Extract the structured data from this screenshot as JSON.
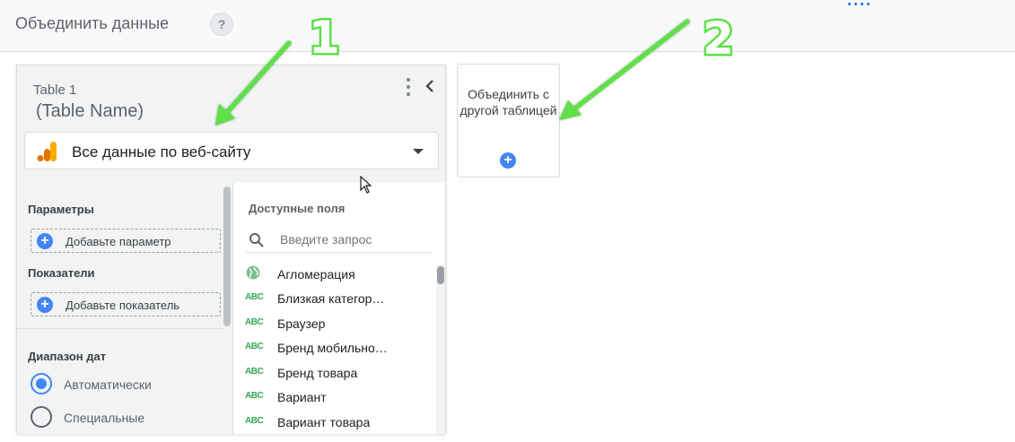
{
  "header": {
    "title": "Объединить данные",
    "help_icon": "?"
  },
  "panel": {
    "table_label": "Table 1",
    "table_name": "(Table Name)",
    "data_source": "Все данные по веб-сайту",
    "data_source_icon": "google-analytics-icon",
    "parameters": {
      "label": "Параметры",
      "add_label": "Добавьте параметр"
    },
    "metrics": {
      "label": "Показатели",
      "add_label": "Добавьте показатель"
    },
    "date_range": {
      "label": "Диапазон дат",
      "options": [
        {
          "label": "Автоматически",
          "selected": true
        },
        {
          "label": "Специальные",
          "selected": false
        }
      ]
    },
    "available_fields": {
      "title": "Доступные поля",
      "search_placeholder": "Введите запрос",
      "fields": [
        {
          "type": "geo",
          "type_icon": "globe-icon",
          "label": "Агломерация"
        },
        {
          "type": "ABC",
          "label": "Близкая категор…"
        },
        {
          "type": "ABC",
          "label": "Браузер"
        },
        {
          "type": "ABC",
          "label": "Бренд мобильно…"
        },
        {
          "type": "ABC",
          "label": "Бренд товара"
        },
        {
          "type": "ABC",
          "label": "Вариант"
        },
        {
          "type": "ABC",
          "label": "Вариант товара"
        }
      ]
    }
  },
  "join_card": {
    "label": "Объединить с другой таблицей",
    "plus": "+"
  },
  "annotations": [
    {
      "label": "1",
      "color": "#5fe048"
    },
    {
      "label": "2",
      "color": "#5fe048"
    }
  ],
  "colors": {
    "accent": "#4285f4",
    "ga_orange": "#f9ab00",
    "ga_dark_orange": "#e37400",
    "field_green": "#34a853"
  }
}
